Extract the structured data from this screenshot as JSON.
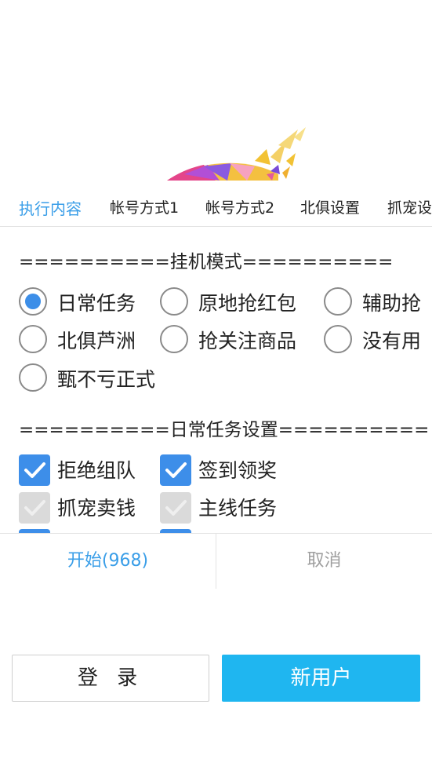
{
  "tabs": [
    "执行内容",
    "帐号方式1",
    "帐号方式2",
    "北俱设置",
    "抓宠设"
  ],
  "mode_section": {
    "title": "==========挂机模式=========="
  },
  "mode_options": [
    "日常任务",
    "原地抢红包",
    "辅助抢",
    "北俱芦洲",
    "抢关注商品",
    "没有用",
    "甄不亏正式"
  ],
  "mode_selected": "日常任务",
  "daily_section": {
    "title": "==========日常任务设置=========="
  },
  "daily_options": [
    "拒绝组队",
    "签到领奖",
    "抓宠卖钱",
    "主线任务"
  ],
  "daily_states": [
    "checked",
    "checked",
    "disabled",
    "disabled",
    "checked",
    "checked"
  ],
  "buttons": {
    "start": "开始(968)",
    "cancel": "取消",
    "login": "登 录",
    "new_user": "新用户"
  },
  "colors": {
    "accent": "#3a9ee8",
    "check": "#3d8ee9",
    "new_user_bg": "#1fb6f0"
  }
}
